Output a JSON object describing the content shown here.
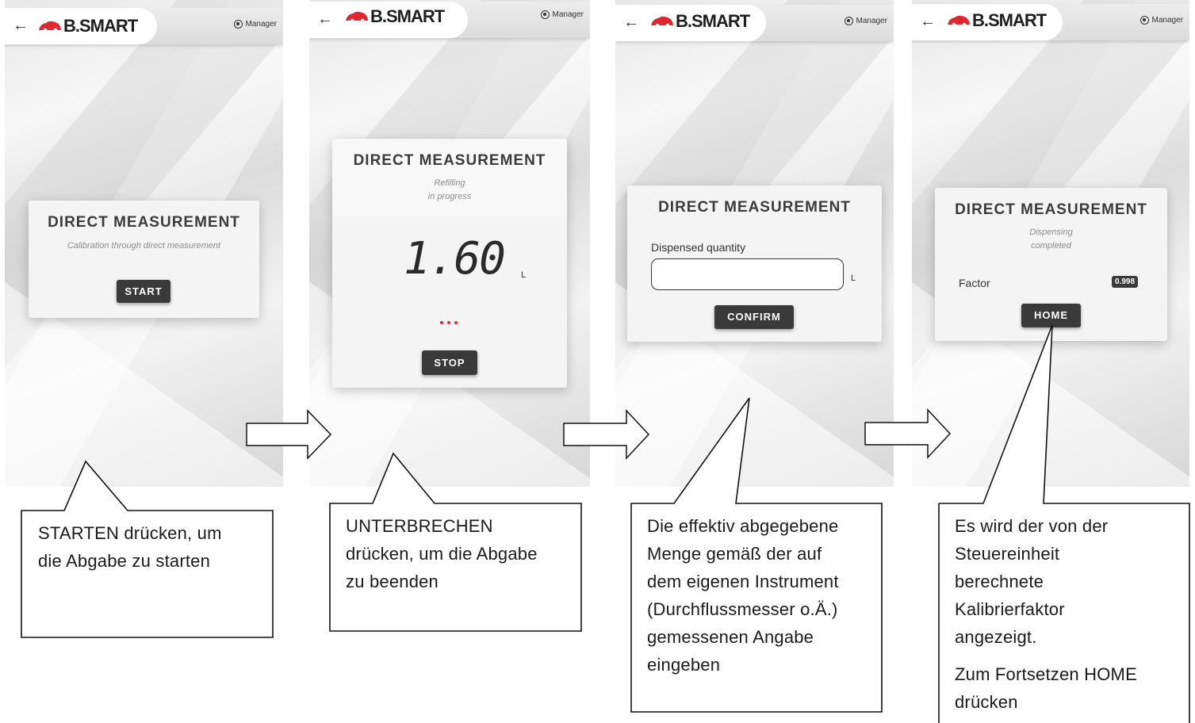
{
  "app": {
    "logo": "B.SMART",
    "user": "Manager"
  },
  "screens": [
    {
      "card_title": "DIRECT MEASUREMENT",
      "subtitle": "Calibration through direct measurement",
      "button": "START"
    },
    {
      "card_title": "DIRECT MEASUREMENT",
      "status_line1": "Refilling",
      "status_line2": "in progress",
      "reading": "1.60",
      "unit": "L",
      "button": "STOP"
    },
    {
      "card_title": "DIRECT MEASUREMENT",
      "field_label": "Dispensed quantity",
      "field_value": "",
      "unit": "L",
      "button": "CONFIRM"
    },
    {
      "card_title": "DIRECT MEASUREMENT",
      "status_line1": "Dispensing",
      "status_line2": "completed",
      "factor_label": "Factor",
      "factor_value": "0.998",
      "button": "HOME"
    }
  ],
  "callouts": [
    {
      "bold": "STARTEN",
      "lines": [
        " drücken, um",
        "die Abgabe zu starten"
      ]
    },
    {
      "bold": "UNTERBRECHEN",
      "lines": [
        "drücken, um die Abgabe",
        "zu beenden"
      ]
    },
    {
      "lines": [
        "Die effektiv abgegebene",
        "Menge gemäß der auf",
        "dem eigenen Instrument",
        "(Durchflussmesser o.Ä.)",
        "gemessenen Angabe",
        "eingeben"
      ]
    },
    {
      "lines": [
        "Es wird der von der",
        "Steuereinheit",
        "berechnete",
        "Kalibrierfaktor",
        "angezeigt."
      ],
      "line6_pre": "Zum Fortsetzen ",
      "line6_bold": "HOME",
      "line7": "drücken"
    }
  ],
  "colors": {
    "button": "#3a3a3a",
    "logo_red": "#e0262f",
    "dots_red": "#e0262f"
  },
  "icons": {
    "back": "back-arrow-icon",
    "user": "user-circle-icon",
    "logo": "car-logo-icon"
  }
}
